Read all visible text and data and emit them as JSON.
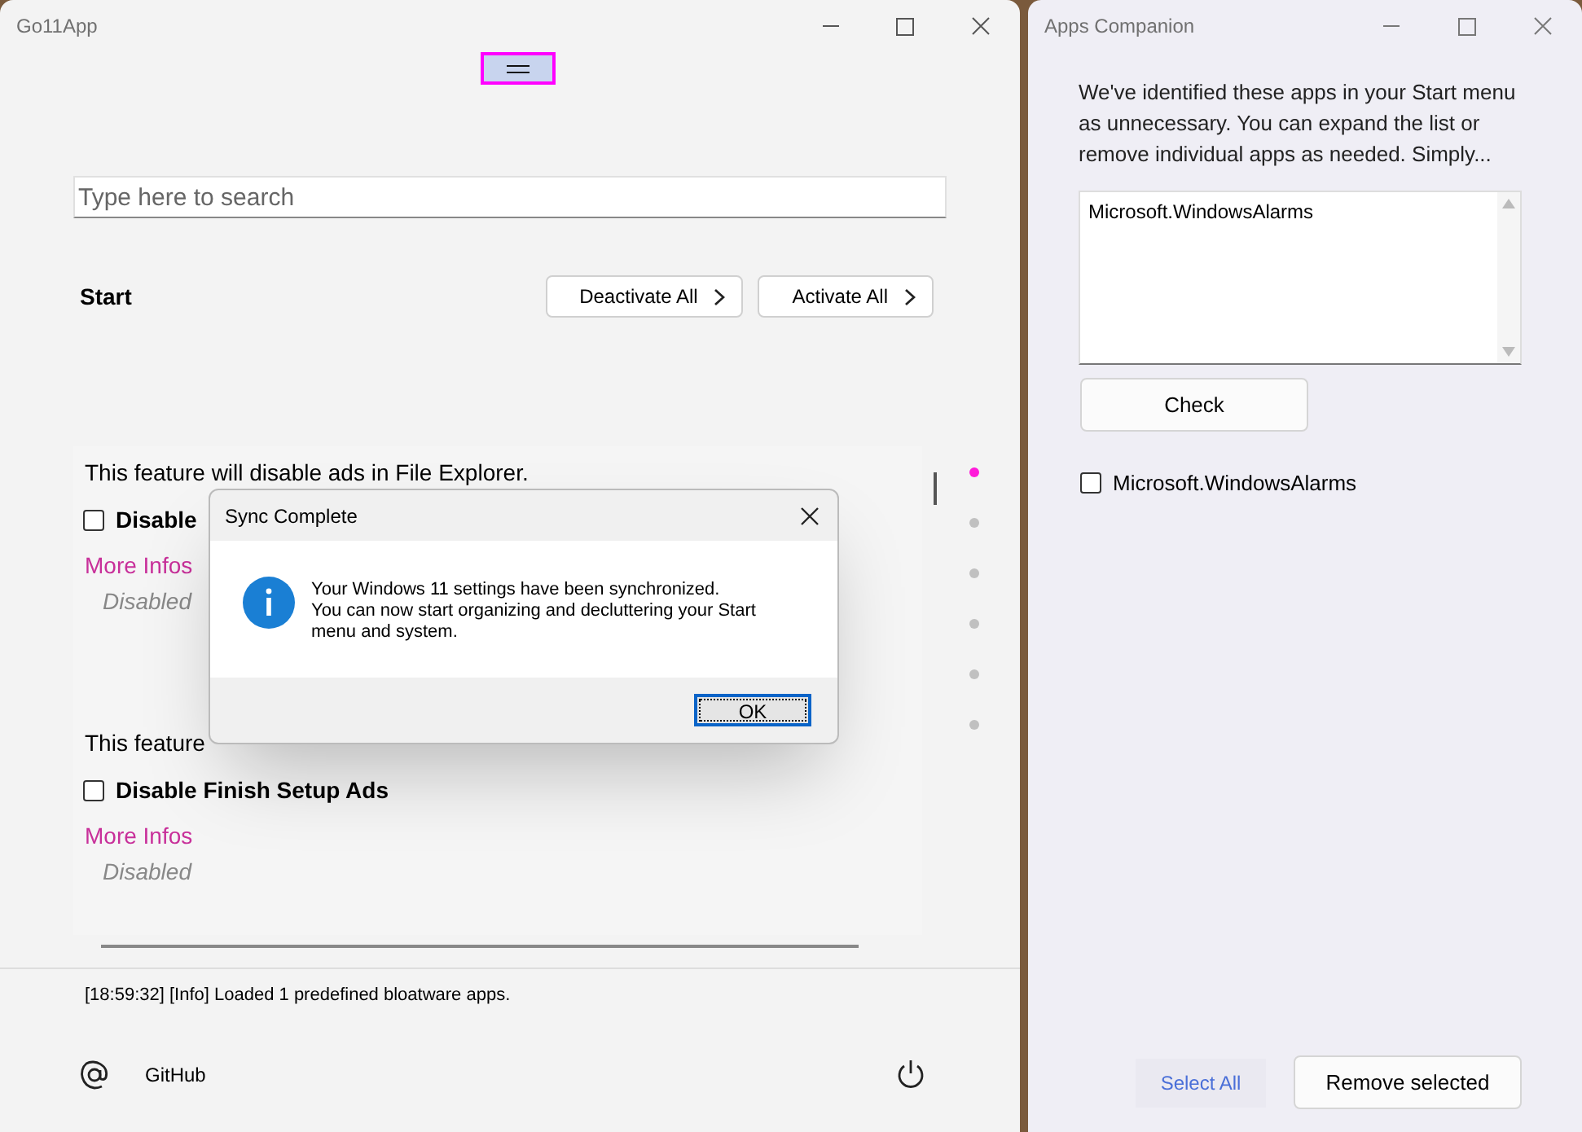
{
  "main_window": {
    "title": "Go11App"
  },
  "search": {
    "placeholder": "Type here to search"
  },
  "section": "Start",
  "actions": [
    "Deactivate All",
    "Activate All"
  ],
  "features": [
    {
      "description": "This feature will disable ads in File Explorer.",
      "label": "Disable",
      "checked": false,
      "link": "More Infos",
      "status": "Disabled"
    },
    {
      "description": "This feature",
      "label": "Disable Finish Setup Ads",
      "checked": false,
      "link": "More Infos",
      "status": "Disabled"
    }
  ],
  "pager": [
    {
      "selected": true
    },
    {
      "selected": false
    },
    {
      "selected": false
    },
    {
      "selected": false
    },
    {
      "selected": false
    },
    {
      "selected": false
    }
  ],
  "log": "[18:59:32] [Info] Loaded 1 predefined bloatware apps.",
  "footer": {
    "link": "GitHub"
  },
  "dialog": {
    "title": "Sync Complete",
    "message": "Your Windows 11 settings have been synchronized.\nYou can now start organizing and decluttering your Start menu and system.",
    "button": "OK"
  },
  "companion": {
    "title": "Apps Companion",
    "intro": "We've identified these apps in your Start menu as unnecessary. You can expand the list or remove individual apps as needed. Simply...",
    "list": [
      "Microsoft.WindowsAlarms"
    ],
    "check_button": "Check",
    "apps": [
      {
        "label": "Microsoft.WindowsAlarms",
        "checked": false
      }
    ],
    "select_all": "Select All",
    "remove": "Remove selected"
  }
}
